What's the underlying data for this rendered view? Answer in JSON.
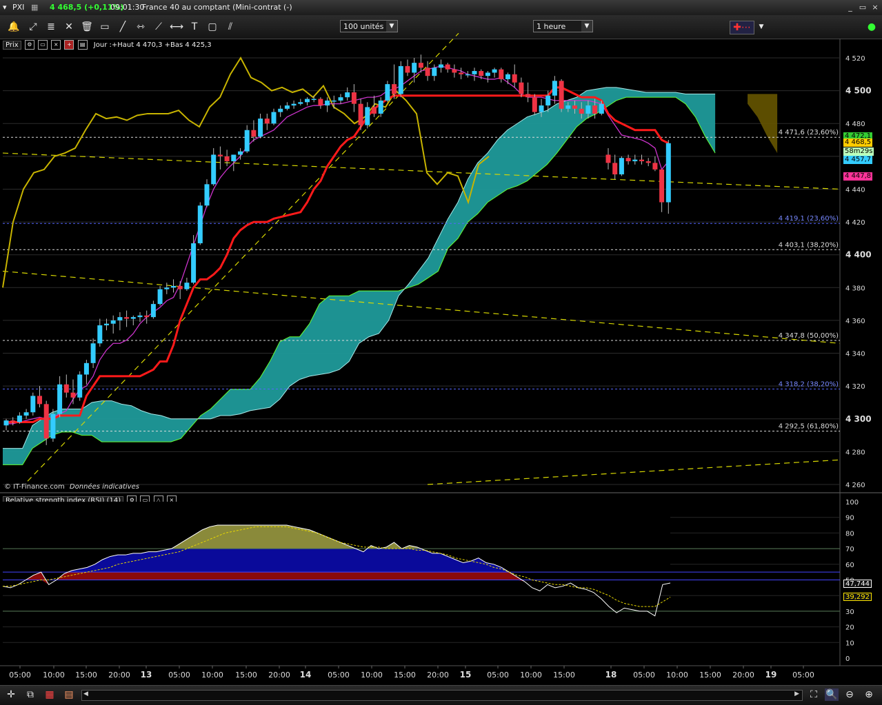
{
  "window": {
    "symbol": "PXI",
    "price_change": "4 468,5 (+0,11%)",
    "time": "09:01:30",
    "instrument": "France 40 au comptant (Mini-contrat  (-)",
    "controls": [
      "_",
      "▭",
      "×"
    ]
  },
  "toolbar": {
    "units": "100 unités",
    "timeframe": "1 heure"
  },
  "price_panel": {
    "name": "Prix",
    "info": "Jour :+Haut 4 470,3 +Bas 4 425,3",
    "watermark": "© IT-Finance.com",
    "watermark_note": "Données indicatives"
  },
  "rsi_panel": {
    "name": "Relative strength index (RSI) (14)"
  },
  "colors": {
    "bull": "#33ccff",
    "bear": "#ee3344",
    "kijun": "#ff1a1a",
    "tenkan": "#cc33cc",
    "chikou": "#c8b400",
    "cloud": "#1f9a9a",
    "cloud_edge": "#66ff33"
  },
  "chart_data": {
    "type": "candlestick",
    "y_axis": {
      "ticks": [
        4520,
        4500,
        4480,
        4460,
        4440,
        4420,
        4400,
        4380,
        4360,
        4340,
        4320,
        4300,
        4280,
        4260
      ],
      "tick_labels": [
        "4 520",
        "4 500",
        "4 480",
        "4 460",
        "4 440",
        "4 420",
        "4 400",
        "4 380",
        "4 360",
        "4 340",
        "4 320",
        "4 300",
        "4 280",
        "4 260"
      ],
      "major_labels": [
        "4 500",
        "4 400",
        "4 300"
      ]
    },
    "x_axis": {
      "tick_labels": [
        "05:00",
        "10:00",
        "15:00",
        "20:00",
        "13",
        "05:00",
        "10:00",
        "15:00",
        "20:00",
        "14",
        "05:00",
        "10:00",
        "15:00",
        "20:00",
        "15",
        "05:00",
        "10:00",
        "15:00",
        "18",
        "05:00",
        "10:00",
        "15:00",
        "20:00",
        "19",
        "05:00"
      ]
    },
    "fibonacci_levels": [
      {
        "value": 4471.6,
        "label": "4 471,6 (23,60%)"
      },
      {
        "value": 4419.1,
        "label": "4 419,1 (23,60%)"
      },
      {
        "value": 4403.1,
        "label": "4 403,1 (38,20%)"
      },
      {
        "value": 4347.8,
        "label": "4 347,8 (50,00%)"
      },
      {
        "value": 4318.2,
        "label": "4 318,2 (38,20%)"
      },
      {
        "value": 4292.5,
        "label": "4 292,5 (61,80%)"
      }
    ],
    "price_badges": [
      {
        "label": "4 472,1",
        "value": 4472.1
      },
      {
        "label": "4 468,5",
        "value": 4468.5
      },
      {
        "label": "58m29s",
        "value": 4463.0
      },
      {
        "label": "4 457,7",
        "value": 4457.7
      },
      {
        "label": "4 447,8",
        "value": 4447.8
      }
    ],
    "candles": [
      [
        4296,
        4300,
        4293,
        4299
      ],
      [
        4299,
        4301,
        4296,
        4298
      ],
      [
        4298,
        4304,
        4297,
        4302
      ],
      [
        4302,
        4306,
        4300,
        4304
      ],
      [
        4304,
        4316,
        4302,
        4314
      ],
      [
        4314,
        4320,
        4307,
        4309
      ],
      [
        4309,
        4311,
        4284,
        4288
      ],
      [
        4288,
        4306,
        4286,
        4303
      ],
      [
        4303,
        4326,
        4301,
        4321
      ],
      [
        4321,
        4327,
        4313,
        4316
      ],
      [
        4316,
        4324,
        4309,
        4313
      ],
      [
        4313,
        4329,
        4311,
        4327
      ],
      [
        4327,
        4336,
        4321,
        4334
      ],
      [
        4334,
        4349,
        4331,
        4346
      ],
      [
        4346,
        4361,
        4344,
        4357
      ],
      [
        4357,
        4361,
        4354,
        4358
      ],
      [
        4358,
        4363,
        4352,
        4360
      ],
      [
        4360,
        4365,
        4354,
        4362
      ],
      [
        4362,
        4366,
        4356,
        4361
      ],
      [
        4361,
        4363,
        4357,
        4362
      ],
      [
        4362,
        4365,
        4359,
        4363
      ],
      [
        4363,
        4366,
        4358,
        4362
      ],
      [
        4362,
        4372,
        4361,
        4370
      ],
      [
        4370,
        4381,
        4369,
        4379
      ],
      [
        4379,
        4383,
        4376,
        4380
      ],
      [
        4380,
        4385,
        4377,
        4381
      ],
      [
        4381,
        4384,
        4373,
        4379
      ],
      [
        4379,
        4386,
        4378,
        4383
      ],
      [
        4383,
        4412,
        4382,
        4407
      ],
      [
        4407,
        4432,
        4406,
        4430
      ],
      [
        4430,
        4446,
        4429,
        4443
      ],
      [
        4443,
        4465,
        4442,
        4461
      ],
      [
        4461,
        4466,
        4452,
        4460
      ],
      [
        4460,
        4464,
        4454,
        4457
      ],
      [
        4457,
        4461,
        4451,
        4461
      ],
      [
        4461,
        4465,
        4458,
        4463
      ],
      [
        4463,
        4479,
        4462,
        4476
      ],
      [
        4476,
        4482,
        4469,
        4472
      ],
      [
        4472,
        4486,
        4471,
        4483
      ],
      [
        4483,
        4486,
        4476,
        4480
      ],
      [
        4480,
        4489,
        4479,
        4487
      ],
      [
        4487,
        4491,
        4484,
        4489
      ],
      [
        4489,
        4493,
        4488,
        4491
      ],
      [
        4491,
        4494,
        4489,
        4492
      ],
      [
        4492,
        4495,
        4491,
        4493
      ],
      [
        4493,
        4496,
        4491,
        4495
      ],
      [
        4495,
        4497,
        4493,
        4495
      ],
      [
        4495,
        4496,
        4489,
        4491
      ],
      [
        4491,
        4496,
        4487,
        4494
      ],
      [
        4494,
        4497,
        4489,
        4494
      ],
      [
        4494,
        4498,
        4492,
        4496
      ],
      [
        4496,
        4502,
        4494,
        4499
      ],
      [
        4499,
        4504,
        4487,
        4492
      ],
      [
        4492,
        4495,
        4476,
        4479
      ],
      [
        4479,
        4493,
        4477,
        4490
      ],
      [
        4490,
        4497,
        4484,
        4486
      ],
      [
        4486,
        4496,
        4484,
        4494
      ],
      [
        4494,
        4506,
        4493,
        4504
      ],
      [
        4504,
        4516,
        4495,
        4498
      ],
      [
        4498,
        4518,
        4496,
        4515
      ],
      [
        4515,
        4519,
        4509,
        4511
      ],
      [
        4511,
        4520,
        4505,
        4517
      ],
      [
        4517,
        4522,
        4511,
        4514
      ],
      [
        4514,
        4518,
        4506,
        4509
      ],
      [
        4509,
        4516,
        4506,
        4514
      ],
      [
        4514,
        4519,
        4511,
        4516
      ],
      [
        4516,
        4517,
        4511,
        4513
      ],
      [
        4513,
        4516,
        4508,
        4511
      ],
      [
        4511,
        4514,
        4507,
        4510
      ],
      [
        4510,
        4512,
        4508,
        4510
      ],
      [
        4510,
        4514,
        4506,
        4512
      ],
      [
        4512,
        4513,
        4507,
        4509
      ],
      [
        4509,
        4512,
        4505,
        4511
      ],
      [
        4511,
        4514,
        4508,
        4513
      ],
      [
        4513,
        4514,
        4505,
        4507
      ],
      [
        4507,
        4511,
        4504,
        4510
      ],
      [
        4510,
        4516,
        4502,
        4505
      ],
      [
        4505,
        4508,
        4496,
        4498
      ],
      [
        4498,
        4505,
        4493,
        4496
      ],
      [
        4496,
        4498,
        4485,
        4487
      ],
      [
        4487,
        4495,
        4484,
        4491
      ],
      [
        4491,
        4500,
        4487,
        4497
      ],
      [
        4497,
        4509,
        4492,
        4506
      ],
      [
        4506,
        4507,
        4487,
        4489
      ],
      [
        4489,
        4493,
        4487,
        4491
      ],
      [
        4491,
        4494,
        4486,
        4489
      ],
      [
        4489,
        4493,
        4483,
        4486
      ],
      [
        4486,
        4494,
        4483,
        4491
      ],
      [
        4491,
        4495,
        4483,
        4486
      ],
      [
        4486,
        4494,
        4485,
        4492
      ],
      [
        4461,
        4465,
        4452,
        4456
      ],
      [
        4456,
        4461,
        4446,
        4449
      ],
      [
        4449,
        4460,
        4448,
        4459
      ],
      [
        4459,
        4461,
        4455,
        4457
      ],
      [
        4457,
        4461,
        4455,
        4458
      ],
      [
        4458,
        4461,
        4455,
        4457
      ],
      [
        4457,
        4459,
        4454,
        4456
      ],
      [
        4456,
        4460,
        4451,
        4452
      ],
      [
        4452,
        4452,
        4426,
        4432
      ],
      [
        4432,
        4470,
        4425,
        4468
      ]
    ],
    "kijun": [
      4298,
      4298,
      4298,
      4298,
      4298,
      4300,
      4300,
      4300,
      4302,
      4302,
      4302,
      4302,
      4314,
      4320,
      4326,
      4326,
      4326,
      4326,
      4326,
      4326,
      4326,
      4328,
      4330,
      4335,
      4335,
      4345,
      4360,
      4370,
      4380,
      4385,
      4385,
      4388,
      4392,
      4400,
      4410,
      4415,
      4418,
      4420,
      4420,
      4420,
      4422,
      4423,
      4424,
      4425,
      4426,
      4432,
      4440,
      4445,
      4454,
      4460,
      4466,
      4470,
      4472,
      4478,
      4484,
      4489,
      4492,
      4495,
      4497,
      4497,
      4497,
      4497,
      4497,
      4497,
      4497,
      4497,
      4497,
      4497,
      4497,
      4497,
      4497,
      4497,
      4497,
      4497,
      4497,
      4497,
      4497,
      4497,
      4497,
      4497,
      4497,
      4497,
      4502,
      4502,
      4500,
      4498,
      4496,
      4496,
      4496,
      4494,
      4486,
      4482,
      4480,
      4478,
      4476,
      4476,
      4476,
      4476,
      4470,
      4468
    ],
    "tenkan": [
      4297,
      4297,
      4298,
      4299,
      4300,
      4301,
      4300,
      4301,
      4303,
      4305,
      4312,
      4318,
      4320,
      4326,
      4336,
      4342,
      4346,
      4346,
      4348,
      4352,
      4358,
      4362,
      4365,
      4368,
      4372,
      4374,
      4382,
      4394,
      4406,
      4418,
      4430,
      4440,
      4447,
      4452,
      4456,
      4460,
      4466,
      4470,
      4472,
      4474,
      4476,
      4480,
      4484,
      4486,
      4488,
      4490,
      4491,
      4491,
      4492,
      4492,
      4492,
      4493,
      4494,
      4495,
      4496,
      4496,
      4497,
      4500,
      4501,
      4503,
      4506,
      4509,
      4512,
      4513,
      4514,
      4515,
      4514,
      4513,
      4512,
      4510,
      4509,
      4508,
      4507,
      4507,
      4508,
      4505,
      4502,
      4498,
      4496,
      4496,
      4496,
      4495,
      4494,
      4494,
      4494,
      4494,
      4494,
      4494,
      4493,
      4492,
      4485,
      4479,
      4473,
      4472,
      4471,
      4470,
      4468,
      4465,
      4452,
      4457
    ],
    "chikou": [
      4380,
      4420,
      4440,
      4450,
      4452,
      4460,
      4462,
      4465,
      4476,
      4486,
      4483,
      4484,
      4482,
      4485,
      4486,
      4486,
      4486,
      4488,
      4482,
      4478,
      4490,
      4496,
      4510,
      4520,
      4508,
      4505,
      4500,
      4502,
      4499,
      4501,
      4496,
      4503,
      4490,
      4486,
      4480,
      4484,
      4492,
      4490,
      4500,
      4494,
      4486,
      4450,
      4443,
      4450,
      4448,
      4432,
      4455,
      4460
    ],
    "senkou_a": [
      4282,
      4282,
      4282,
      4296,
      4300,
      4304,
      4306,
      4306,
      4306,
      4310,
      4311,
      4311,
      4309,
      4308,
      4305,
      4303,
      4302,
      4300,
      4300,
      4300,
      4300,
      4300,
      4302,
      4302,
      4303,
      4305,
      4306,
      4307,
      4312,
      4320,
      4324,
      4326,
      4327,
      4328,
      4330,
      4335,
      4346,
      4350,
      4352,
      4360,
      4375,
      4382,
      4390,
      4398,
      4410,
      4422,
      4432,
      4446,
      4456,
      4462,
      4470,
      4476,
      4480,
      4484,
      4486,
      4488,
      4492,
      4494,
      4496,
      4500,
      4501,
      4502,
      4502,
      4501,
      4500,
      4499,
      4499,
      4499,
      4499,
      4498,
      4498,
      4498,
      4498,
      4497,
      4497,
      4496,
      4496,
      4496,
      4496,
      4496,
      4496,
      4496,
      4485
    ],
    "senkou_b": [
      4272,
      4272,
      4272,
      4282,
      4286,
      4290,
      4292,
      4292,
      4290,
      4290,
      4286,
      4286,
      4286,
      4286,
      4286,
      4286,
      4286,
      4286,
      4288,
      4295,
      4302,
      4306,
      4312,
      4318,
      4318,
      4318,
      4325,
      4335,
      4347,
      4350,
      4350,
      4358,
      4370,
      4375,
      4375,
      4375,
      4378,
      4378,
      4378,
      4378,
      4378,
      4380,
      4382,
      4386,
      4390,
      4404,
      4410,
      4420,
      4425,
      4432,
      4436,
      4440,
      4442,
      4445,
      4450,
      4455,
      4462,
      4470,
      4478,
      4483,
      4486,
      4490,
      4494,
      4496,
      4496,
      4496,
      4496,
      4496,
      4496,
      4492,
      4484,
      4472,
      4462
    ],
    "trendlines": [
      {
        "style": "dashed",
        "from": [
          0,
          4462
        ],
        "to": 4440
      },
      {
        "style": "dashed",
        "from": [
          0,
          4390
        ],
        "to": 4346
      },
      {
        "style": "dashed",
        "from": [
          0,
          4260
        ],
        "to": 4275
      },
      {
        "style": "dashed",
        "from": [
          0,
          4262
        ],
        "to": 4535
      }
    ],
    "rsi": {
      "ticks": [
        100,
        90,
        80,
        70,
        60,
        50,
        40,
        30,
        20,
        10,
        0
      ],
      "tick_labels": [
        "100",
        "90",
        "80",
        "70",
        "60",
        "50",
        "40",
        "30",
        "20",
        "10",
        "0"
      ],
      "last_value_label": "47,744",
      "signal_value_label": "39,292",
      "last_value": 47.744,
      "signal_value": 39.292,
      "rsi_values": [
        46,
        45,
        47,
        50,
        53,
        55,
        47,
        50,
        54,
        56,
        57,
        58,
        60,
        63,
        65,
        66,
        66,
        67,
        67,
        68,
        68,
        69,
        70,
        73,
        76,
        79,
        82,
        84,
        85,
        85,
        85,
        85,
        85,
        85,
        85,
        85,
        85,
        85,
        84,
        83,
        82,
        80,
        78,
        76,
        74,
        72,
        70,
        68,
        72,
        70,
        71,
        74,
        70,
        72,
        71,
        69,
        67,
        67,
        65,
        63,
        61,
        62,
        64,
        61,
        60,
        58,
        55,
        52,
        49,
        45,
        43,
        47,
        45,
        46,
        48,
        45,
        44,
        42,
        38,
        33,
        29,
        32,
        31,
        30,
        30,
        27,
        47,
        48
      ],
      "signal_values": [
        46,
        46,
        47,
        48,
        49,
        50,
        50,
        51,
        52,
        53,
        54,
        55,
        56,
        57,
        58,
        60,
        61,
        62,
        63,
        64,
        65,
        66,
        67,
        68,
        70,
        72,
        74,
        76,
        78,
        80,
        81,
        82,
        83,
        84,
        84,
        84,
        84,
        84,
        83,
        82,
        81,
        80,
        78,
        76,
        74,
        73,
        72,
        71,
        71,
        71,
        70,
        70,
        70,
        70,
        69,
        69,
        68,
        67,
        66,
        64,
        63,
        62,
        61,
        60,
        58,
        57,
        55,
        53,
        52,
        50,
        49,
        48,
        47,
        47,
        46,
        45,
        45,
        44,
        42,
        40,
        37,
        35,
        34,
        33,
        33,
        33,
        36,
        39
      ]
    }
  }
}
